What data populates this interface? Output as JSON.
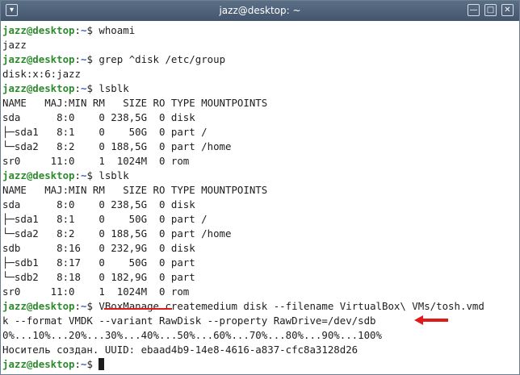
{
  "window": {
    "title": "jazz@desktop: ~"
  },
  "prompt": {
    "user": "jazz@desktop",
    "colon": ":",
    "path": "~",
    "symbol": "$ "
  },
  "lines": [
    {
      "type": "prompt",
      "cmd": "whoami"
    },
    {
      "type": "out",
      "text": "jazz"
    },
    {
      "type": "prompt",
      "cmd": "grep ^disk /etc/group"
    },
    {
      "type": "out",
      "text": "disk:x:6:jazz"
    },
    {
      "type": "prompt",
      "cmd": "lsblk"
    },
    {
      "type": "out",
      "text": "NAME   MAJ:MIN RM   SIZE RO TYPE MOUNTPOINTS"
    },
    {
      "type": "out",
      "text": "sda      8:0    0 238,5G  0 disk"
    },
    {
      "type": "out",
      "text": "├─sda1   8:1    0    50G  0 part /"
    },
    {
      "type": "out",
      "text": "└─sda2   8:2    0 188,5G  0 part /home"
    },
    {
      "type": "out",
      "text": "sr0     11:0    1  1024M  0 rom"
    },
    {
      "type": "prompt",
      "cmd": "lsblk"
    },
    {
      "type": "out",
      "text": "NAME   MAJ:MIN RM   SIZE RO TYPE MOUNTPOINTS"
    },
    {
      "type": "out",
      "text": "sda      8:0    0 238,5G  0 disk"
    },
    {
      "type": "out",
      "text": "├─sda1   8:1    0    50G  0 part /"
    },
    {
      "type": "out",
      "text": "└─sda2   8:2    0 188,5G  0 part /home"
    },
    {
      "type": "out",
      "text": "sdb      8:16   0 232,9G  0 disk"
    },
    {
      "type": "out",
      "text": "├─sdb1   8:17   0    50G  0 part"
    },
    {
      "type": "out",
      "text": "└─sdb2   8:18   0 182,9G  0 part"
    },
    {
      "type": "out",
      "text": "sr0     11:0    1  1024M  0 rom"
    },
    {
      "type": "prompt",
      "cmd": "VBoxManage createmedium disk --filename VirtualBox\\ VMs/tosh.vmd"
    },
    {
      "type": "out",
      "text": "k --format VMDK --variant RawDisk --property RawDrive=/dev/sdb"
    },
    {
      "type": "out",
      "text": "0%...10%...20%...30%...40%...50%...60%...70%...80%...90%...100%"
    },
    {
      "type": "out",
      "text": "Носитель создан. UUID: ebaad4b9-14e8-4616-a837-cfc8a3128d26"
    },
    {
      "type": "prompt_active",
      "cmd": ""
    }
  ],
  "annotation": {
    "color": "#e01919"
  }
}
